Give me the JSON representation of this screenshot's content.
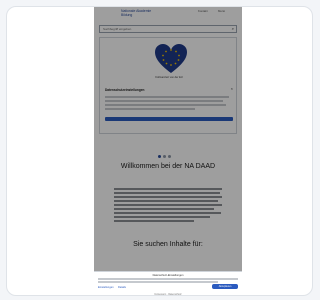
{
  "header": {
    "logo_line1": "Nationale Akademie",
    "logo_line2": "Bildung",
    "nav_links": [
      "Kontakt",
      "Menü"
    ]
  },
  "search": {
    "placeholder": "Suchbegriff eingeben"
  },
  "cookie_modal": {
    "eu_caption": "Kofinanziert von der EU",
    "title": "Datenschutzeinstellungen",
    "button_label": "Alle akzeptieren"
  },
  "main": {
    "welcome_title": "Willkommen bei der NA DAAD",
    "search_heading": "Sie suchen Inhalte für:"
  },
  "bottom_sheet": {
    "title": "Datenschutz-Einstellungen",
    "link_1": "Einstellungen",
    "link_2": "Details",
    "accept_label": "Akzeptieren",
    "footer": "Impressum · Datenschutz"
  },
  "colors": {
    "brand": "#2b4c9b",
    "accent": "#2b5bbf",
    "heart": "#1f3a8a",
    "stars": "#f2c200"
  }
}
